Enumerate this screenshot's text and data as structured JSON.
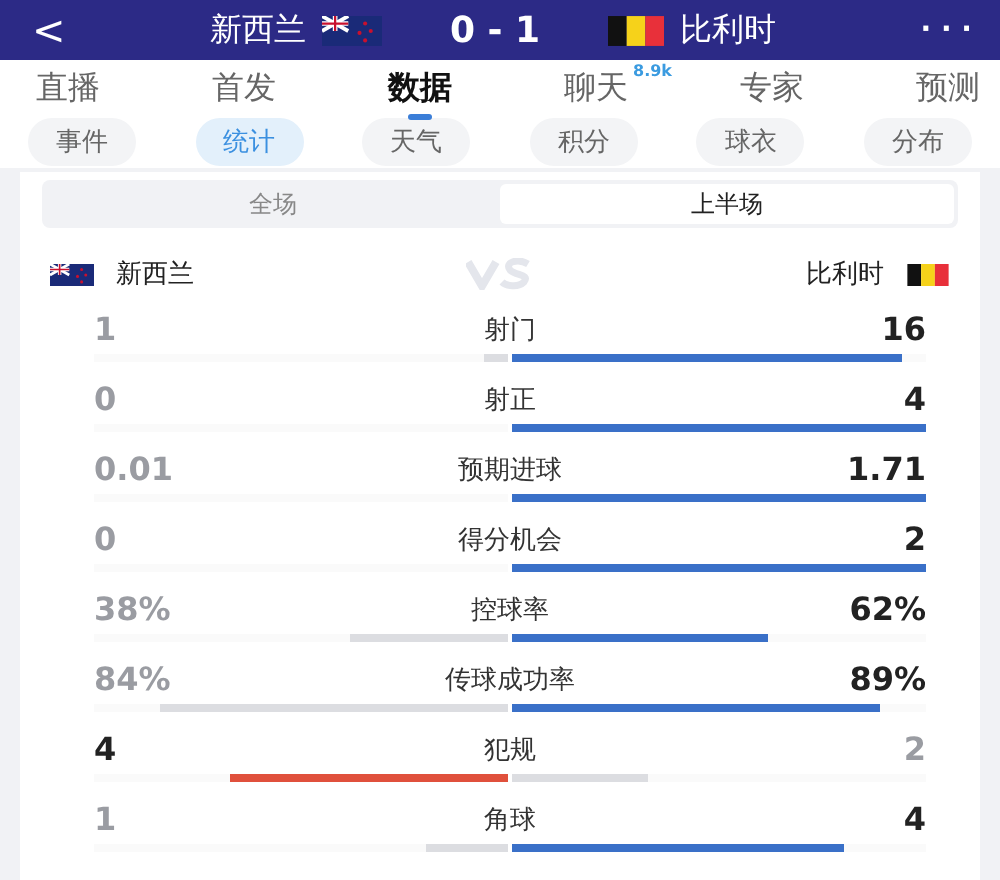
{
  "header": {
    "back": "<",
    "home_team": "新西兰",
    "score": "0 - 1",
    "away_team": "比利时",
    "more": "· · ·"
  },
  "tabs": [
    {
      "label": "直播",
      "selected": false
    },
    {
      "label": "首发",
      "selected": false
    },
    {
      "label": "数据",
      "selected": true
    },
    {
      "label": "聊天",
      "selected": false,
      "badge": "8.9k"
    },
    {
      "label": "专家",
      "selected": false
    },
    {
      "label": "预测",
      "selected": false
    }
  ],
  "chips": [
    {
      "label": "事件",
      "selected": false
    },
    {
      "label": "统计",
      "selected": true
    },
    {
      "label": "天气",
      "selected": false
    },
    {
      "label": "积分",
      "selected": false
    },
    {
      "label": "球衣",
      "selected": false
    },
    {
      "label": "分布",
      "selected": false
    }
  ],
  "periods": [
    {
      "label": "全场",
      "selected": false
    },
    {
      "label": "上半场",
      "selected": true
    }
  ],
  "teams": {
    "home": "新西兰",
    "away": "比利时"
  },
  "stats": [
    {
      "label": "射门",
      "home": {
        "value": "1",
        "level": 0.06,
        "leading": false
      },
      "away": {
        "value": "16",
        "level": 0.94,
        "leading": true
      }
    },
    {
      "label": "射正",
      "home": {
        "value": "0",
        "leading": false
      },
      "away": {
        "value": "4",
        "level": 1,
        "leading": true
      }
    },
    {
      "label": "预期进球",
      "home": {
        "value": "0.01",
        "leading": false
      },
      "away": {
        "value": "1.71",
        "level": 1,
        "leading": true
      }
    },
    {
      "label": "得分机会",
      "home": {
        "value": "0",
        "leading": false
      },
      "away": {
        "value": "2",
        "level": 1,
        "leading": true
      }
    },
    {
      "label": "控球率",
      "home": {
        "value": "38%",
        "level": 0.38,
        "leading": false
      },
      "away": {
        "value": "62%",
        "level": 0.62,
        "leading": true
      }
    },
    {
      "label": "传球成功率",
      "home": {
        "value": "84%",
        "level": 0.84,
        "leading": false
      },
      "away": {
        "value": "89%",
        "level": 0.89,
        "leading": true
      }
    },
    {
      "label": "犯规",
      "home": {
        "value": "4",
        "level": 0.67,
        "leading": true
      },
      "away": {
        "value": "2",
        "level": 0.33,
        "leading": false
      }
    },
    {
      "label": "角球",
      "home": {
        "value": "1",
        "level": 0.2,
        "leading": false
      },
      "away": {
        "value": "4",
        "level": 0.8,
        "leading": true
      }
    }
  ]
}
